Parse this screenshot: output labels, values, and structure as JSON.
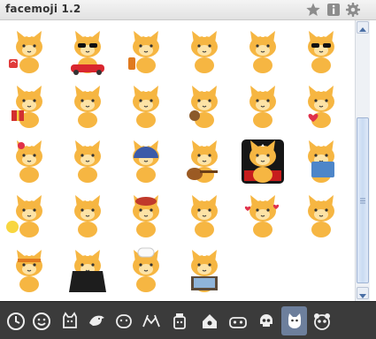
{
  "window": {
    "title": "facemoji 1.2"
  },
  "toolbar": {
    "star_icon": "star-icon",
    "info_icon": "info-icon",
    "gear_icon": "gear-icon"
  },
  "grid": {
    "rows": 5,
    "columns": 6,
    "stickers": [
      "cat-heart-mug",
      "cat-sunglasses-car",
      "cat-bottle",
      "cat-dog-crying",
      "cat-star-wink",
      "cat-sunglasses",
      "cat-gift",
      "cat-plain",
      "cat-flowers",
      "cat-teddy-bear",
      "cat-holding-cookie",
      "cat-heart",
      "cat-flower-ear",
      "cat-laughing-tears",
      "cat-football-helmet",
      "cat-guitar",
      "cat-theater",
      "cat-reading-book",
      "cat-emoji-face",
      "cat-crying",
      "cat-red-hat",
      "cat-angel",
      "cat-hearts-love",
      "cat-shy",
      "cat-headband",
      "cat-mustache-cape",
      "cat-chef",
      "cat-computer"
    ]
  },
  "tabs": [
    {
      "icon": "clock-icon",
      "active": false
    },
    {
      "icon": "smiley-icon",
      "active": false
    },
    {
      "icon": "monster-icon",
      "active": false
    },
    {
      "icon": "bird-icon",
      "active": false
    },
    {
      "icon": "ghost-face-icon",
      "active": false
    },
    {
      "icon": "spider-icon",
      "active": false
    },
    {
      "icon": "robot-jar-icon",
      "active": false
    },
    {
      "icon": "house-icon",
      "active": false
    },
    {
      "icon": "car-face-icon",
      "active": false
    },
    {
      "icon": "skull-icon",
      "active": false
    },
    {
      "icon": "cat-icon",
      "active": true
    },
    {
      "icon": "panda-icon",
      "active": false
    }
  ],
  "colors": {
    "cat_fur": "#f6b642",
    "cat_fur_light": "#fde3a6",
    "tabbar_bg": "#3b3b3b",
    "tab_active": "#6d7f9c"
  }
}
